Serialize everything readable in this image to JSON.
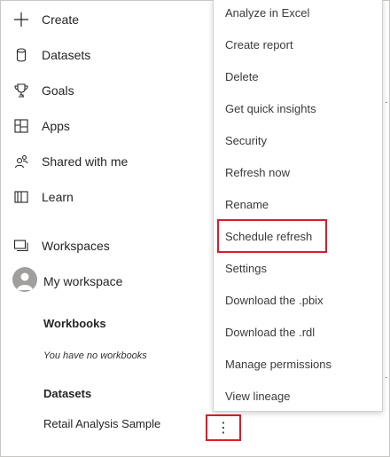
{
  "nav": {
    "items": [
      {
        "label": "Create",
        "icon": "plus-icon"
      },
      {
        "label": "Datasets",
        "icon": "database-icon"
      },
      {
        "label": "Goals",
        "icon": "trophy-icon"
      },
      {
        "label": "Apps",
        "icon": "apps-icon"
      },
      {
        "label": "Shared with me",
        "icon": "shared-users-icon"
      },
      {
        "label": "Learn",
        "icon": "book-icon"
      }
    ],
    "workspaces_label": "Workspaces",
    "my_workspace_label": "My workspace"
  },
  "workspace": {
    "workbooks_heading": "Workbooks",
    "workbooks_empty": "You have no workbooks",
    "datasets_heading": "Datasets",
    "dataset_name": "Retail Analysis Sample",
    "more_options_glyph": "⋮"
  },
  "context_menu": {
    "items": [
      "Analyze in Excel",
      "Create report",
      "Delete",
      "Get quick insights",
      "Security",
      "Refresh now",
      "Rename",
      "Schedule refresh",
      "Settings",
      "Download the .pbix",
      "Download the .rdl",
      "Manage permissions",
      "View lineage"
    ],
    "highlighted_item": "Schedule refresh"
  },
  "colors": {
    "highlight_border": "#d81e2c",
    "text": "#252423",
    "menu_text": "#3b3a39"
  }
}
